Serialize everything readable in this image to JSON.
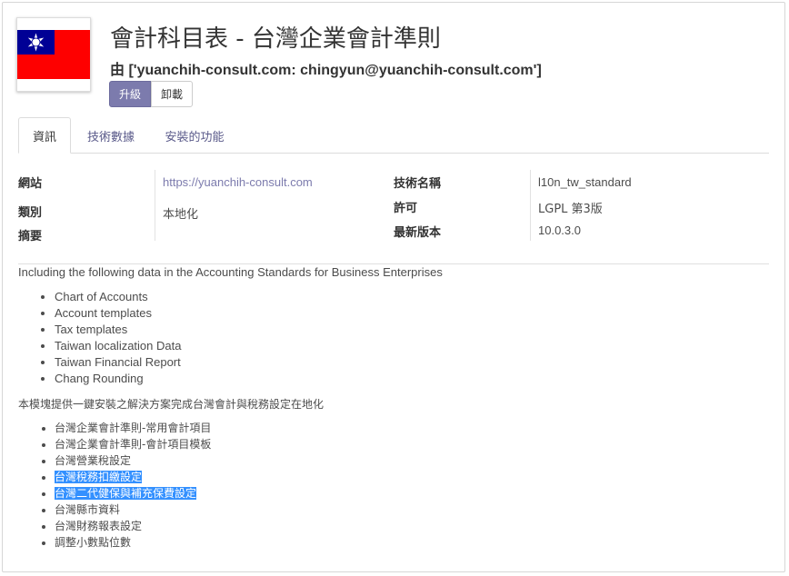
{
  "module": {
    "title": "會計科目表 - 台灣企業會計準則",
    "author": "由 ['yuanchih-consult.com: chingyun@yuanchih-consult.com']",
    "icon": "taiwan-flag-icon"
  },
  "buttons": {
    "upgrade": "升級",
    "uninstall": "卸載"
  },
  "tabs": [
    {
      "label": "資訊",
      "active": true
    },
    {
      "label": "技術數據",
      "active": false
    },
    {
      "label": "安裝的功能",
      "active": false
    }
  ],
  "info": {
    "website_label": "網站",
    "website_value": "https://yuanchih-consult.com",
    "category_label": "類別",
    "category_value": "本地化",
    "summary_label": "摘要",
    "tech_name_label": "技術名稱",
    "tech_name_value": "l10n_tw_standard",
    "license_label": "許可",
    "license_value": "LGPL 第3版",
    "version_label": "最新版本",
    "version_value": "10.0.3.0"
  },
  "description": {
    "intro_en": "Including the following data in the Accounting Standards for Business Enterprises",
    "items_en": [
      "Chart of Accounts",
      "Account templates",
      "Tax templates",
      "Taiwan localization Data",
      "Taiwan Financial Report",
      "Chang Rounding"
    ],
    "intro_zh": "本模塊提供一鍵安裝之解決方案完成台灣會計與稅務設定在地化",
    "items_zh": [
      "台灣企業會計準則-常用會計項目",
      "台灣企業會計準則-會計項目模板",
      "台灣營業稅設定",
      "台灣稅務扣繳設定",
      "台灣二代健保與補充保費設定",
      "台灣縣市資料",
      "台灣財務報表設定",
      "調整小數點位數"
    ]
  },
  "colors": {
    "accent": "#7c7bad",
    "selection": "#3390ff",
    "flag_red": "#fe0000",
    "flag_blue": "#000095"
  }
}
